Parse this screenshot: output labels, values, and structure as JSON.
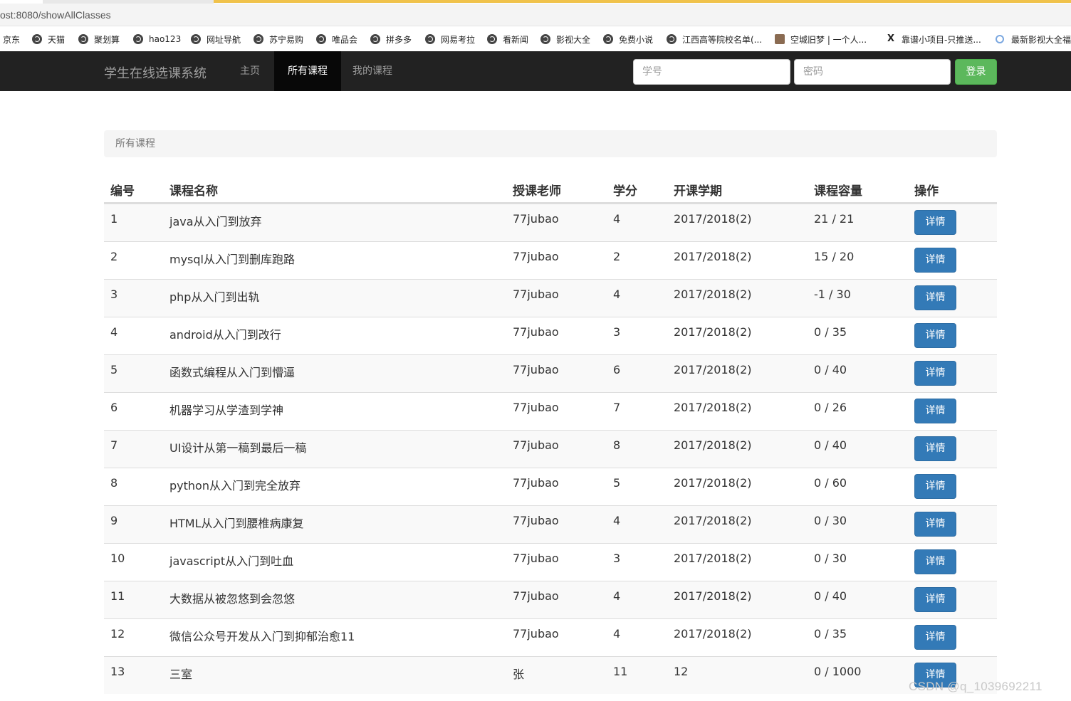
{
  "browser": {
    "address": "ost:8080/showAllClasses",
    "bookmarks": [
      {
        "label": "京东",
        "icon": "none"
      },
      {
        "label": "天猫",
        "icon": "globe-icon"
      },
      {
        "label": "聚划算",
        "icon": "globe-icon"
      },
      {
        "label": "hao123",
        "icon": "globe-icon"
      },
      {
        "label": "网址导航",
        "icon": "globe-icon"
      },
      {
        "label": "苏宁易购",
        "icon": "globe-icon"
      },
      {
        "label": "唯品会",
        "icon": "globe-icon"
      },
      {
        "label": "拼多多",
        "icon": "globe-icon"
      },
      {
        "label": "网易考拉",
        "icon": "globe-icon"
      },
      {
        "label": "看新闻",
        "icon": "globe-icon"
      },
      {
        "label": "影视大全",
        "icon": "globe-icon"
      },
      {
        "label": "免费小说",
        "icon": "globe-icon"
      },
      {
        "label": "江西高等院校名单(...",
        "icon": "globe-icon"
      },
      {
        "label": "空城旧梦 | 一个人...",
        "icon": "image-icon"
      },
      {
        "label": "靠谱小项目-只推送...",
        "icon": "x-icon"
      },
      {
        "label": "最新影视大全福",
        "icon": "bowl-icon"
      }
    ]
  },
  "navbar": {
    "brand": "学生在线选课系统",
    "links": [
      "主页",
      "所有课程",
      "我的课程"
    ],
    "active_link": "所有课程",
    "student_id_placeholder": "学号",
    "password_placeholder": "密码",
    "login_label": "登录"
  },
  "breadcrumb": "所有课程",
  "table": {
    "headers": [
      "编号",
      "课程名称",
      "授课老师",
      "学分",
      "开课学期",
      "课程容量",
      "操作"
    ],
    "detail_label": "详情",
    "rows": [
      {
        "id": "1",
        "name": "java从入门到放弃",
        "teacher": "77jubao",
        "credit": "4",
        "term": "2017/2018(2)",
        "capacity": "21 / 21"
      },
      {
        "id": "2",
        "name": "mysql从入门到删库跑路",
        "teacher": "77jubao",
        "credit": "2",
        "term": "2017/2018(2)",
        "capacity": "15 / 20"
      },
      {
        "id": "3",
        "name": "php从入门到出轨",
        "teacher": "77jubao",
        "credit": "4",
        "term": "2017/2018(2)",
        "capacity": "-1 / 30"
      },
      {
        "id": "4",
        "name": "android从入门到改行",
        "teacher": "77jubao",
        "credit": "3",
        "term": "2017/2018(2)",
        "capacity": "0 / 35"
      },
      {
        "id": "5",
        "name": "函数式编程从入门到懵逼",
        "teacher": "77jubao",
        "credit": "6",
        "term": "2017/2018(2)",
        "capacity": "0 / 40"
      },
      {
        "id": "6",
        "name": "机器学习从学渣到学神",
        "teacher": "77jubao",
        "credit": "7",
        "term": "2017/2018(2)",
        "capacity": "0 / 26"
      },
      {
        "id": "7",
        "name": "UI设计从第一稿到最后一稿",
        "teacher": "77jubao",
        "credit": "8",
        "term": "2017/2018(2)",
        "capacity": "0 / 40"
      },
      {
        "id": "8",
        "name": "python从入门到完全放弃",
        "teacher": "77jubao",
        "credit": "5",
        "term": "2017/2018(2)",
        "capacity": "0 / 60"
      },
      {
        "id": "9",
        "name": "HTML从入门到腰椎病康复",
        "teacher": "77jubao",
        "credit": "4",
        "term": "2017/2018(2)",
        "capacity": "0 / 30"
      },
      {
        "id": "10",
        "name": "javascript从入门到吐血",
        "teacher": "77jubao",
        "credit": "3",
        "term": "2017/2018(2)",
        "capacity": "0 / 30"
      },
      {
        "id": "11",
        "name": "大数据从被忽悠到会忽悠",
        "teacher": "77jubao",
        "credit": "4",
        "term": "2017/2018(2)",
        "capacity": "0 / 40"
      },
      {
        "id": "12",
        "name": "微信公众号开发从入门到抑郁治愈11",
        "teacher": "77jubao",
        "credit": "4",
        "term": "2017/2018(2)",
        "capacity": "0 / 35"
      },
      {
        "id": "13",
        "name": "三室",
        "teacher": "张",
        "credit": "11",
        "term": "12",
        "capacity": "0 / 1000"
      }
    ]
  },
  "watermark": "CSDN @q_1039692211",
  "colors": {
    "navbar_bg": "#222222",
    "navbar_active_bg": "#080808",
    "login_button": "#5cb85c",
    "detail_button": "#337ab7",
    "browser_accent": "#f0c24b"
  }
}
